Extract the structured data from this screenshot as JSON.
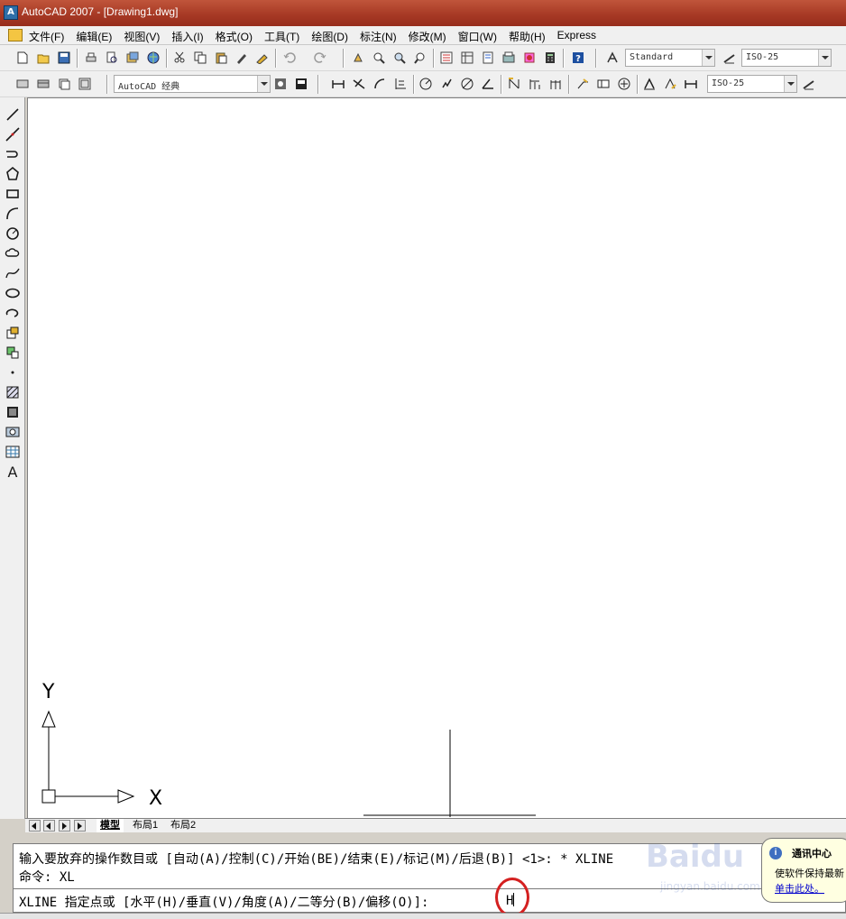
{
  "window": {
    "title": "AutoCAD 2007 - [Drawing1.dwg]",
    "icon": "autocad-icon"
  },
  "menu": [
    "文件(F)",
    "编辑(E)",
    "视图(V)",
    "插入(I)",
    "格式(O)",
    "工具(T)",
    "绘图(D)",
    "标注(N)",
    "修改(M)",
    "窗口(W)",
    "帮助(H)",
    "Express"
  ],
  "toolbar": {
    "text_style": "Standard",
    "dim_style": "ISO-25",
    "workspace": "AutoCAD 经典",
    "dim_style_2": "ISO-25"
  },
  "ucs": {
    "x_label": "X",
    "y_label": "Y"
  },
  "tabs": {
    "model": "模型",
    "layout1": "布局1",
    "layout2": "布局2"
  },
  "command": {
    "history_1": "输入要放弃的操作数目或 [自动(A)/控制(C)/开始(BE)/结束(E)/标记(M)/后退(B)] <1>: * XLINE",
    "history_2": "命令: XL",
    "prompt": "XLINE 指定点或 [水平(H)/垂直(V)/角度(A)/二等分(B)/偏移(O)]:",
    "input": "H"
  },
  "comm_center": {
    "title": "通讯中心",
    "message": "使软件保持最新",
    "link": "单击此处。"
  },
  "watermark": {
    "logo": "Baidu",
    "sub": "jingyan.baidu.com"
  },
  "colors": {
    "titlebar": "#a83a25",
    "highlight_circle": "#d42020",
    "canvas": "#ffffff"
  }
}
